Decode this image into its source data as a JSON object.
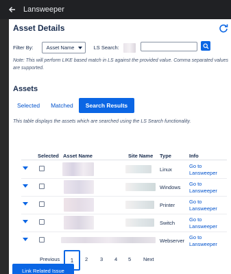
{
  "window": {
    "title": "Lansweeper"
  },
  "page": {
    "title": "Asset Details"
  },
  "filter": {
    "label": "Filter By:",
    "selected": "Asset Name",
    "search_label": "LS Search:",
    "search_value": ""
  },
  "note": "Note: This will perform LIKE based match in LS against the provided value. Comma separated values are supported.",
  "assets": {
    "title": "Assets",
    "tabs": [
      "Selected",
      "Matched",
      "Search Results"
    ],
    "active_tab": "Search Results",
    "description": "This table displays the assets which are searched using the LS Search functionality."
  },
  "table": {
    "columns": [
      "Selected",
      "Asset Name",
      "Site Name",
      "Type",
      "Info"
    ],
    "rows": [
      {
        "type": "Linux",
        "info": "Go to Lansweeper"
      },
      {
        "type": "Windows",
        "info": "Go to Lansweeper"
      },
      {
        "type": "Printer",
        "info": "Go to Lansweeper"
      },
      {
        "type": "Switch",
        "info": "Go to Lansweeper"
      },
      {
        "type": "Webserver",
        "info": "Go to Lansweeper"
      }
    ]
  },
  "pagination": {
    "previous": "Previous",
    "pages": [
      "1",
      "2",
      "3",
      "4",
      "5"
    ],
    "current": "1",
    "next": "Next"
  },
  "actions": {
    "link_related_issue": "Link Related Issue"
  },
  "colors": {
    "accent": "#0b66e4",
    "link": "#0052cc",
    "titlebar": "#202124"
  }
}
